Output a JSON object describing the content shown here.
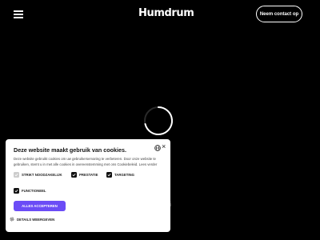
{
  "header": {
    "brand": "Humdrum",
    "contact_label": "Neem contact op"
  },
  "cookie_banner": {
    "title": "Deze website maakt gebruik van cookies.",
    "description": "Deze website gebruikt cookies om uw gebruikerservaring te verbeteren. Door onze website te gebruiken, stemt u in met alle cookies in overeenstemming met ons Cookiebeleid. Lees verder",
    "options": [
      {
        "label": "STRIKT NOODZAKELIJK",
        "checked": true,
        "disabled": true
      },
      {
        "label": "PRESTATIE",
        "checked": true,
        "disabled": false
      },
      {
        "label": "TARGETING",
        "checked": true,
        "disabled": false
      },
      {
        "label": "FUNCTIONEEL",
        "checked": true,
        "disabled": false
      }
    ],
    "accept_label": "ALLES ACCEPTEREN",
    "details_label": "DETAILS WEERGEVEN",
    "close_glyph": "×"
  },
  "misc": {
    "stray_glyph": "i"
  },
  "colors": {
    "background": "#000000",
    "accent": "#6b4cf6",
    "dialog": "#ffffff"
  },
  "icons": [
    "menu-icon",
    "spinner-icon",
    "globe-icon",
    "close-icon",
    "check-icon",
    "gear-icon"
  ]
}
